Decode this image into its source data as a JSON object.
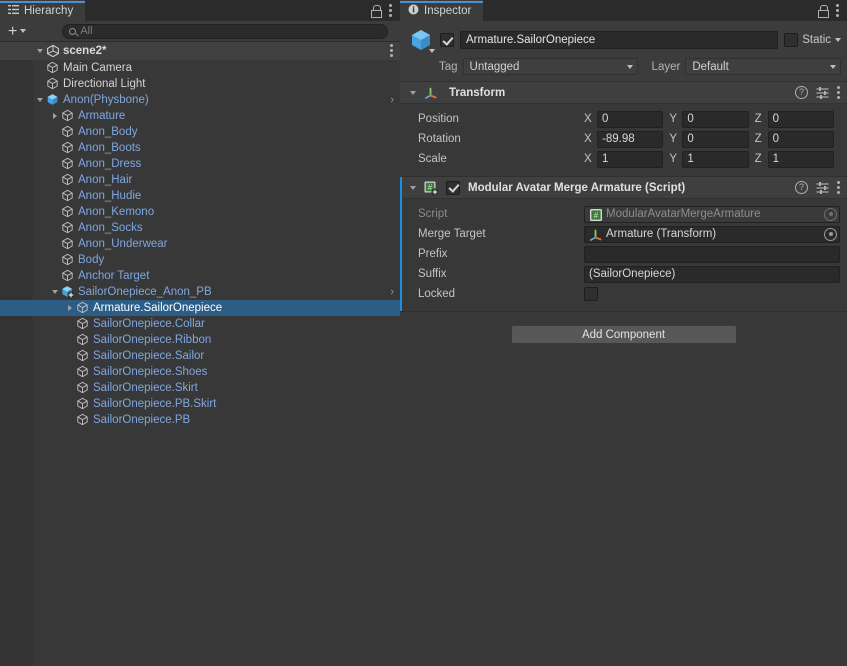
{
  "hierarchy": {
    "tab_label": "Hierarchy",
    "tab_icon": "hierarchy-icon",
    "lock_icon": "lock-icon",
    "menu_icon": "kebab-menu-icon",
    "toolbar": {
      "add_label": "+",
      "add_icon": "plus-icon",
      "add_caret_icon": "chevron-down-icon",
      "search_icon": "search-icon",
      "search_value": "",
      "search_placeholder": "All"
    },
    "scene": {
      "name": "scene2*",
      "icon": "unity-scene-icon",
      "expanded": true,
      "menu_icon": "kebab-menu-icon"
    },
    "items": [
      {
        "label": "Main Camera",
        "depth": 1,
        "icon": "gameobject-cube-icon",
        "style": "white",
        "arrow": "none",
        "chevron": false,
        "selected": false
      },
      {
        "label": "Directional Light",
        "depth": 1,
        "icon": "gameobject-cube-icon",
        "style": "white",
        "arrow": "none",
        "chevron": false,
        "selected": false
      },
      {
        "label": "Anon(Physbone)",
        "depth": 1,
        "icon": "prefab-cube-icon",
        "style": "prefab",
        "arrow": "open",
        "chevron": true,
        "selected": false
      },
      {
        "label": "Armature",
        "depth": 2,
        "icon": "gameobject-cube-icon",
        "style": "prefab",
        "arrow": "closed",
        "chevron": false,
        "selected": false
      },
      {
        "label": "Anon_Body",
        "depth": 2,
        "icon": "gameobject-cube-icon",
        "style": "prefab",
        "arrow": "none",
        "chevron": false,
        "selected": false
      },
      {
        "label": "Anon_Boots",
        "depth": 2,
        "icon": "gameobject-cube-icon",
        "style": "prefab",
        "arrow": "none",
        "chevron": false,
        "selected": false
      },
      {
        "label": "Anon_Dress",
        "depth": 2,
        "icon": "gameobject-cube-icon",
        "style": "prefab",
        "arrow": "none",
        "chevron": false,
        "selected": false
      },
      {
        "label": "Anon_Hair",
        "depth": 2,
        "icon": "gameobject-cube-icon",
        "style": "prefab",
        "arrow": "none",
        "chevron": false,
        "selected": false
      },
      {
        "label": "Anon_Hudie",
        "depth": 2,
        "icon": "gameobject-cube-icon",
        "style": "prefab",
        "arrow": "none",
        "chevron": false,
        "selected": false
      },
      {
        "label": "Anon_Kemono",
        "depth": 2,
        "icon": "gameobject-cube-icon",
        "style": "prefab",
        "arrow": "none",
        "chevron": false,
        "selected": false
      },
      {
        "label": "Anon_Socks",
        "depth": 2,
        "icon": "gameobject-cube-icon",
        "style": "prefab",
        "arrow": "none",
        "chevron": false,
        "selected": false
      },
      {
        "label": "Anon_Underwear",
        "depth": 2,
        "icon": "gameobject-cube-icon",
        "style": "prefab",
        "arrow": "none",
        "chevron": false,
        "selected": false
      },
      {
        "label": "Body",
        "depth": 2,
        "icon": "gameobject-cube-icon",
        "style": "prefab",
        "arrow": "none",
        "chevron": false,
        "selected": false
      },
      {
        "label": "Anchor Target",
        "depth": 2,
        "icon": "gameobject-cube-icon",
        "style": "prefab",
        "arrow": "none",
        "chevron": false,
        "selected": false
      },
      {
        "label": "SailorOnepiece_Anon_PB",
        "depth": 2,
        "icon": "prefab-variant-icon",
        "style": "prefab",
        "arrow": "open",
        "chevron": true,
        "selected": false
      },
      {
        "label": "Armature.SailorOnepiece",
        "depth": 3,
        "icon": "gameobject-cube-icon",
        "style": "selected",
        "arrow": "closed",
        "chevron": false,
        "selected": true
      },
      {
        "label": "SailorOnepiece.Collar",
        "depth": 3,
        "icon": "gameobject-cube-icon",
        "style": "prefab",
        "arrow": "none",
        "chevron": false,
        "selected": false
      },
      {
        "label": "SailorOnepiece.Ribbon",
        "depth": 3,
        "icon": "gameobject-cube-icon",
        "style": "prefab",
        "arrow": "none",
        "chevron": false,
        "selected": false
      },
      {
        "label": "SailorOnepiece.Sailor",
        "depth": 3,
        "icon": "gameobject-cube-icon",
        "style": "prefab",
        "arrow": "none",
        "chevron": false,
        "selected": false
      },
      {
        "label": "SailorOnepiece.Shoes",
        "depth": 3,
        "icon": "gameobject-cube-icon",
        "style": "prefab",
        "arrow": "none",
        "chevron": false,
        "selected": false
      },
      {
        "label": "SailorOnepiece.Skirt",
        "depth": 3,
        "icon": "gameobject-cube-icon",
        "style": "prefab",
        "arrow": "none",
        "chevron": false,
        "selected": false
      },
      {
        "label": "SailorOnepiece.PB.Skirt",
        "depth": 3,
        "icon": "gameobject-cube-icon",
        "style": "prefab",
        "arrow": "none",
        "chevron": false,
        "selected": false
      },
      {
        "label": "SailorOnepiece.PB",
        "depth": 3,
        "icon": "gameobject-cube-icon",
        "style": "prefab",
        "arrow": "none",
        "chevron": false,
        "selected": false
      }
    ]
  },
  "inspector": {
    "tab_label": "Inspector",
    "tab_icon": "info-icon",
    "lock_icon": "lock-icon",
    "menu_icon": "kebab-menu-icon",
    "gameobject": {
      "icon": "gameobject-cube-icon",
      "enabled": true,
      "name": "Armature.SailorOnepiece",
      "static_label": "Static",
      "static_checked": false,
      "tag_label": "Tag",
      "tag_value": "Untagged",
      "layer_label": "Layer",
      "layer_value": "Default"
    },
    "components": [
      {
        "title": "Transform",
        "icon": "transform-axis-icon",
        "expanded": true,
        "has_toggle": false,
        "help_icon": "help-icon",
        "preset_icon": "preset-icon",
        "menu_icon": "kebab-menu-icon",
        "override": false,
        "rows": [
          {
            "type": "vector3",
            "label": "Position",
            "x": "0",
            "y": "0",
            "z": "0"
          },
          {
            "type": "vector3",
            "label": "Rotation",
            "x": "-89.98",
            "y": "0",
            "z": "0"
          },
          {
            "type": "vector3",
            "label": "Scale",
            "x": "1",
            "y": "1",
            "z": "1"
          }
        ]
      },
      {
        "title": "Modular Avatar Merge Armature (Script)",
        "icon": "cs-script-icon",
        "expanded": true,
        "has_toggle": true,
        "enabled": true,
        "help_icon": "help-icon",
        "preset_icon": "preset-icon",
        "menu_icon": "kebab-menu-icon",
        "override": true,
        "rows": [
          {
            "type": "object",
            "label": "Script",
            "value": "ModularAvatarMergeArmature",
            "value_icon": "cs-script-icon",
            "disabled": true
          },
          {
            "type": "object",
            "label": "Merge Target",
            "value": "Armature (Transform)",
            "value_icon": "transform-axis-icon",
            "disabled": false
          },
          {
            "type": "text",
            "label": "Prefix",
            "value": ""
          },
          {
            "type": "text",
            "label": "Suffix",
            "value": "(SailorOnepiece)"
          },
          {
            "type": "check",
            "label": "Locked",
            "checked": false
          }
        ]
      }
    ],
    "add_component_label": "Add Component"
  },
  "axes": {
    "x": "X",
    "y": "Y",
    "z": "Z"
  },
  "colors": {
    "selection_blue": "#2c5d87",
    "prefab_blue": "#7fa7e0",
    "accent_tab": "#4a90d9",
    "override_blue": "#1d8fe0",
    "panel_bg": "#383838",
    "header_bg": "#3c3c3c"
  }
}
